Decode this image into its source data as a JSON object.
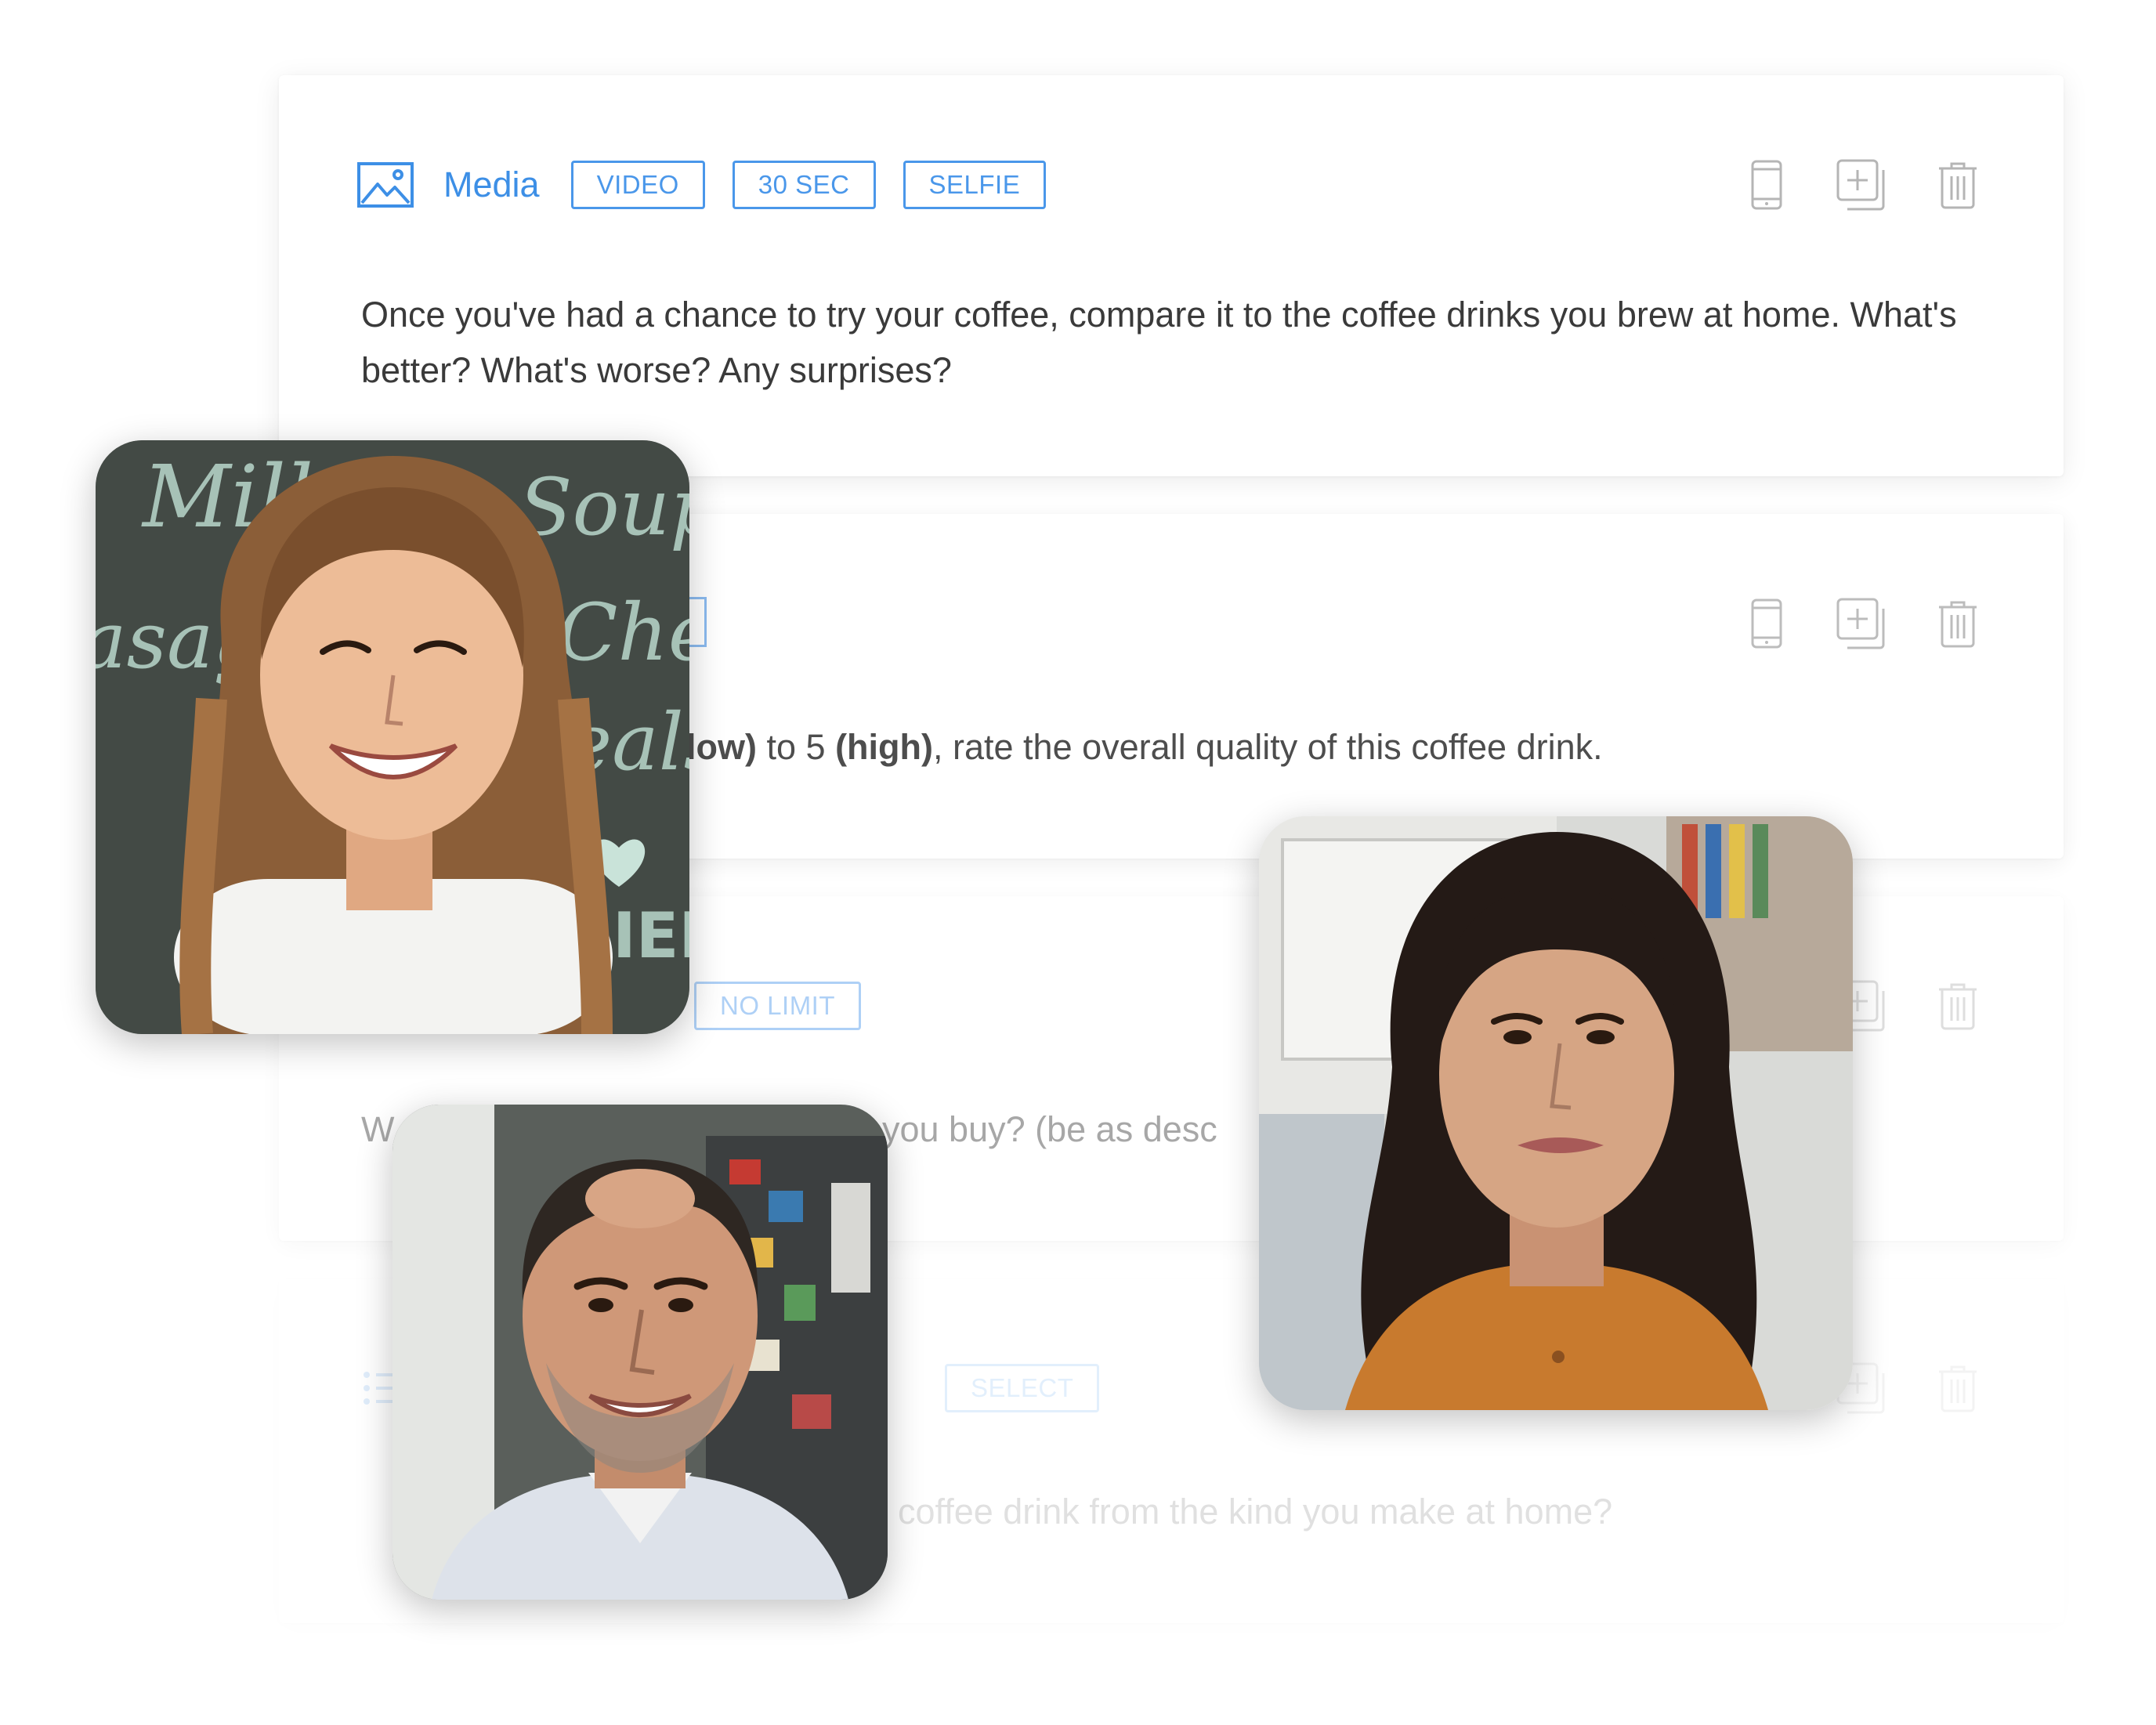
{
  "colors": {
    "accent": "#3d8fe6",
    "icon_gray": "#b5b5b5",
    "text": "#3a3a3a"
  },
  "questions": [
    {
      "type_icon": "image-icon",
      "type_label": "Media",
      "tags": [
        "VIDEO",
        "30 SEC",
        "SELFIE"
      ],
      "prompt": "Once you've had a chance to try your coffee, compare it to the coffee drinks you brew at home. What's better? What's worse? Any surprises?"
    },
    {
      "prompt_part1": "low)",
      "prompt_part2": " to 5 ",
      "prompt_part3": "(high)",
      "prompt_part4": ", rate the overall quality of this coffee drink."
    },
    {
      "tag": "NO LIMIT",
      "prompt_left": "W",
      "prompt_right": "you buy? (be as desc"
    },
    {
      "tag": "SELECT",
      "prompt_right": "coffee drink from the kind you make at home?"
    }
  ],
  "action_icons": [
    "phone-preview-icon",
    "duplicate-icon",
    "trash-icon"
  ]
}
